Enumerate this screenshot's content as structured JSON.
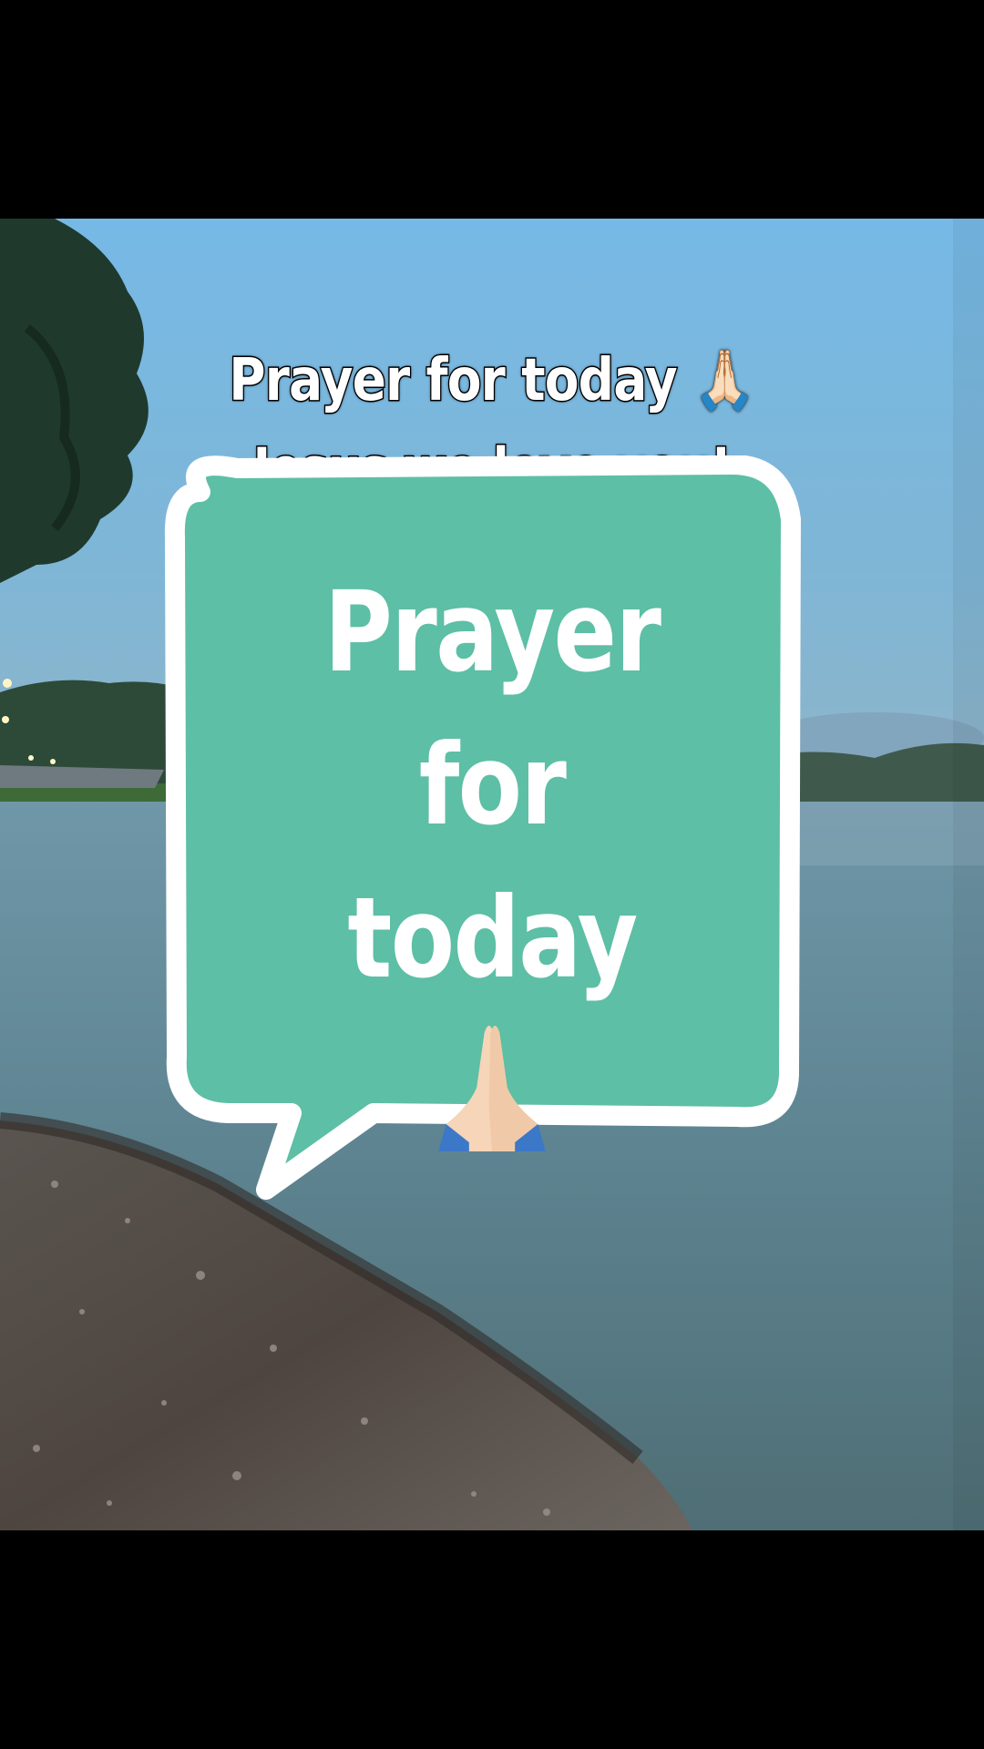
{
  "overlay": {
    "caption_line1": "Prayer for today 🙏🏻",
    "caption_line2": "Jesus we love you!"
  },
  "sticker": {
    "line1": "Prayer",
    "line2": "for",
    "line3": "today",
    "emoji_icon": "praying-hands-icon",
    "fill_color": "#5dbfa5",
    "border_color": "#ffffff"
  }
}
